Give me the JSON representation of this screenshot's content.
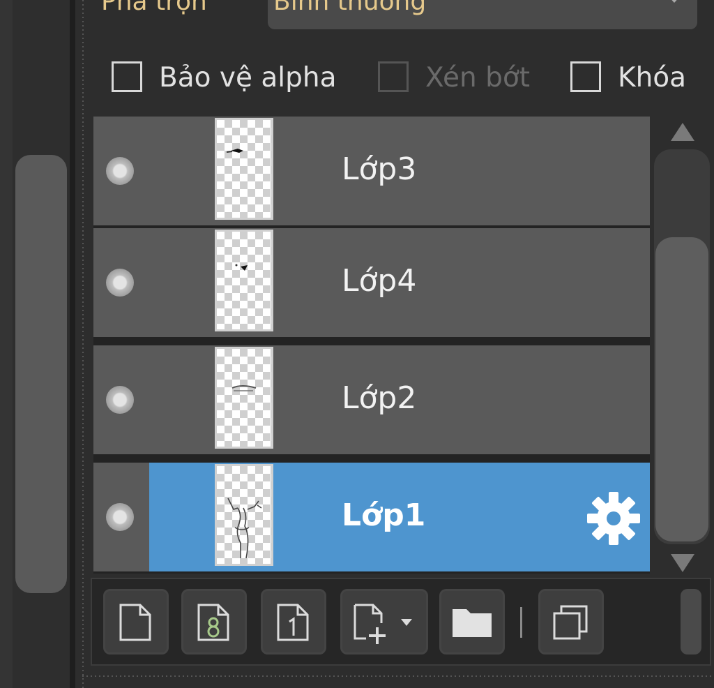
{
  "blend": {
    "label": "Pha trộn",
    "value": "Bình thường"
  },
  "options": {
    "protect_alpha": "Bảo vệ alpha",
    "clipping": "Xén bớt",
    "lock": "Khóa"
  },
  "layers": [
    {
      "name": "Lớp3",
      "selected": false
    },
    {
      "name": "Lớp4",
      "selected": false
    },
    {
      "name": "Lớp2",
      "selected": false
    },
    {
      "name": "Lớp1",
      "selected": true
    }
  ],
  "colors": {
    "selected_row": "#4e95cf",
    "row": "#5a5a5a",
    "accent_text": "#e6c98c",
    "panel": "#2d2d2d"
  },
  "toolbar": {
    "icons": [
      "new-layer-icon",
      "new-8bit-layer-icon",
      "new-1bit-layer-icon",
      "add-layer-dropdown-icon",
      "folder-icon",
      "duplicate-layer-icon"
    ]
  }
}
